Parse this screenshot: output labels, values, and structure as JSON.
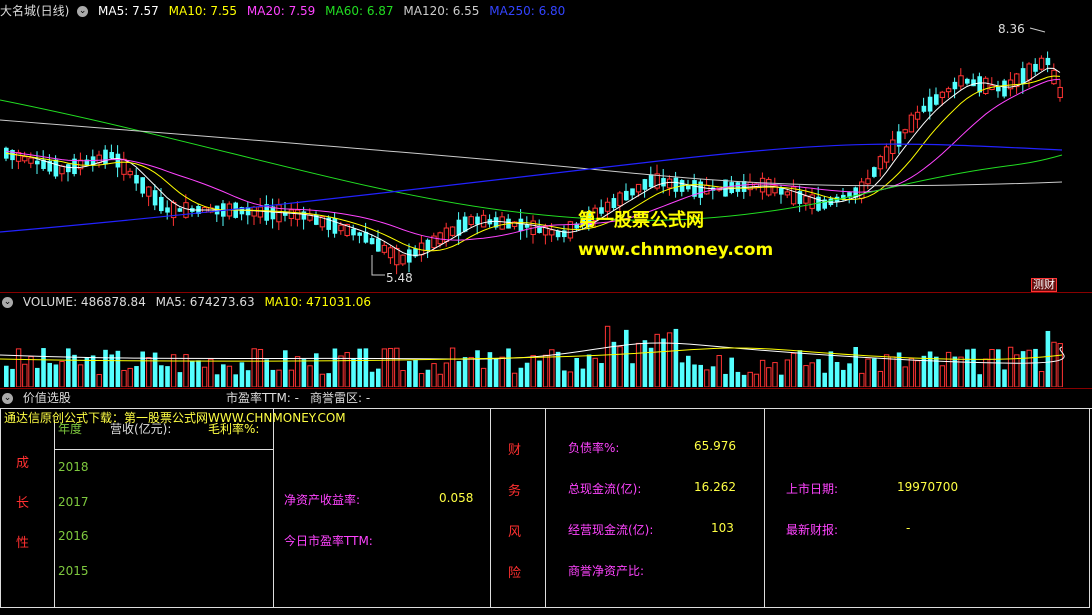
{
  "price_header": {
    "title": "大名城(日线)",
    "ma5": "MA5: 7.57",
    "ma10": "MA10: 7.55",
    "ma20": "MA20: 7.59",
    "ma60": "MA60: 6.87",
    "ma120": "MA120: 6.55",
    "ma250": "MA250: 6.80"
  },
  "price_chart": {
    "high_label": "8.36",
    "low_label": "5.48",
    "watermark_title": "第一股票公式网",
    "watermark_url": "www.chnmoney.com",
    "fin_badge": "测财"
  },
  "volume_header": {
    "volume": "VOLUME: 486878.84",
    "ma5": "MA5: 674273.63",
    "ma10": "MA10: 471031.06"
  },
  "value_header": {
    "title": "价值选股",
    "pe_ttm": "市盈率TTM: -",
    "goodwill": "商誉雷区: -"
  },
  "table": {
    "source_line": "通达信原创公式下载：第一股票公式网WWW.CHNMONEY.COM",
    "col_year": "年度",
    "col_revenue": "营收(亿元):",
    "col_margin": "毛利率%:",
    "growth_chars": [
      "成",
      "长",
      "性"
    ],
    "years": [
      "2018",
      "2017",
      "2016",
      "2015"
    ],
    "roe_label": "净资产收益率:",
    "roe_value": "0.058",
    "today_pe_label": "今日市盈率TTM:",
    "risk_chars": [
      "财",
      "务",
      "风",
      "险"
    ],
    "debt_label": "负债率%:",
    "debt_value": "65.976",
    "cash_label": "总现金流(亿):",
    "cash_value": "16.262",
    "op_cash_label": "经营现金流(亿):",
    "op_cash_value": "103",
    "goodwill_ratio_label": "商誉净资产比:",
    "listing_label": "上市日期:",
    "listing_value": "19970700",
    "report_label": "最新财报:",
    "report_value": "-"
  },
  "colors": {
    "up": "#ff3333",
    "down": "#54ffff",
    "ma5": "#ffffff",
    "ma10": "#ffff00",
    "ma20": "#ff44ff",
    "ma60": "#22dd22",
    "ma120": "#cccccc",
    "ma250": "#2222ff"
  }
}
